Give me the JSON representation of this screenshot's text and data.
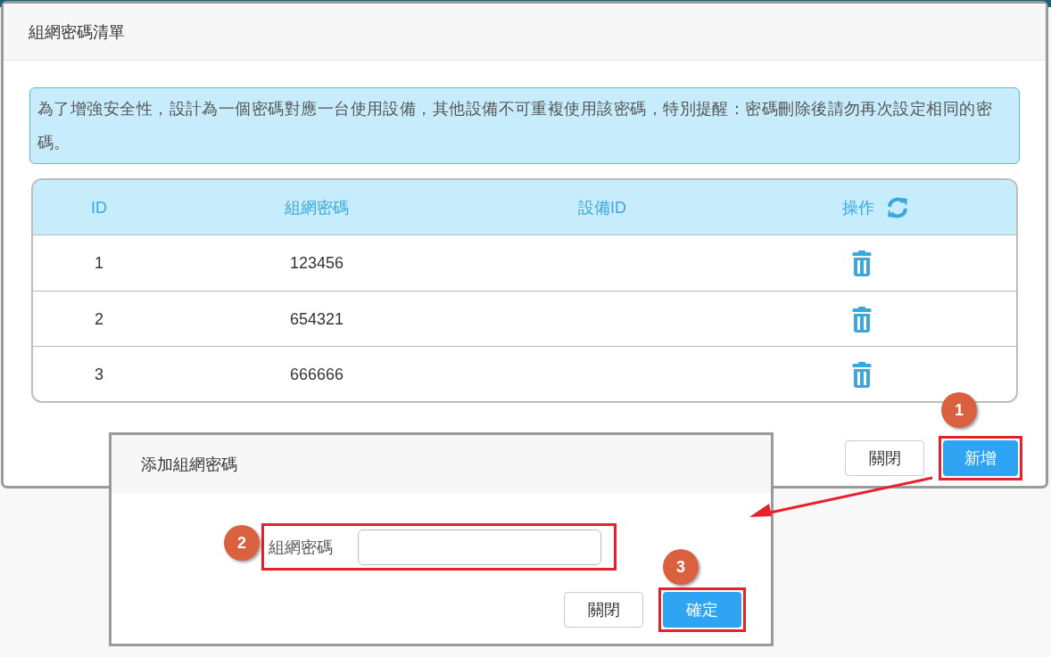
{
  "list_dialog": {
    "title": "組網密碼清單",
    "notice": "為了增強安全性，設計為一個密碼對應一台使用設備，其他設備不可重複使用該密碼，特別提醒：密碼刪除後請勿再次設定相同的密碼。",
    "table": {
      "columns": [
        "ID",
        "組網密碼",
        "設備ID",
        "操作"
      ],
      "rows": [
        {
          "id": "1",
          "password": "123456"
        },
        {
          "id": "2",
          "password": "654321"
        },
        {
          "id": "3",
          "password": "666666"
        }
      ]
    },
    "buttons": [
      {
        "label": "關閉",
        "kind": "default",
        "highlighted": false
      },
      {
        "label": "新增",
        "kind": "primary",
        "highlighted": true
      }
    ]
  },
  "add_dialog": {
    "title": "添加組網密碼",
    "field": {
      "label": "組網密碼",
      "highlighted": true
    },
    "buttons": [
      {
        "label": "關閉",
        "kind": "default",
        "highlighted": false
      },
      {
        "label": "確定",
        "kind": "primary",
        "highlighted": true
      }
    ]
  },
  "annotations": [
    "1",
    "2",
    "3"
  ]
}
